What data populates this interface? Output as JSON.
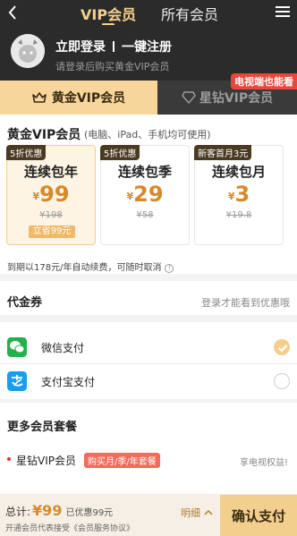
{
  "header": {
    "tab_vip": "VIP会员",
    "tab_all": "所有会员"
  },
  "user": {
    "login": "立即登录",
    "register": "一键注册",
    "subtitle": "请登录后购买黄金VIP会员"
  },
  "vip_tabs": {
    "gold": "黄金VIP会员",
    "star": "星钻VIP会员",
    "star_badge": "电视端也能看"
  },
  "gold": {
    "title": "黄金VIP会员",
    "devices": "(电脑、iPad、手机均可使用)"
  },
  "plans": [
    {
      "tag": "5折优惠",
      "name": "连续包年",
      "currency": "¥",
      "price": "99",
      "original": "¥198",
      "save": "立省99元"
    },
    {
      "tag": "5折优惠",
      "name": "连续包季",
      "currency": "¥",
      "price": "29",
      "original": "¥58"
    },
    {
      "tag": "新客首月3元",
      "name": "连续包月",
      "currency": "¥",
      "price": "3",
      "original": "¥19.8"
    }
  ],
  "autorenew": "到期以178元/年自动续费，可随时取消",
  "coupon": {
    "title": "代金券",
    "hint": "登录才能看到优惠哦"
  },
  "payment": {
    "wechat": "微信支付",
    "alipay": "支付宝支付",
    "selected": "wechat"
  },
  "more": {
    "title": "更多会员套餐",
    "package_name": "星钻VIP会员",
    "package_tag": "购买月/季/年套餐",
    "package_right": "享电视权益!"
  },
  "footer": {
    "total_label": "总计:",
    "total_price": "¥99",
    "discount": "已优惠99元",
    "detail": "明细",
    "agreement": "开通会员代表接受《会员服务协议》",
    "confirm": "确认支付"
  },
  "colors": {
    "dark_bg": "#2b2b2b",
    "gold": "#f2cf8d",
    "price": "#d78a2a",
    "badge_red": "#e8483c"
  }
}
